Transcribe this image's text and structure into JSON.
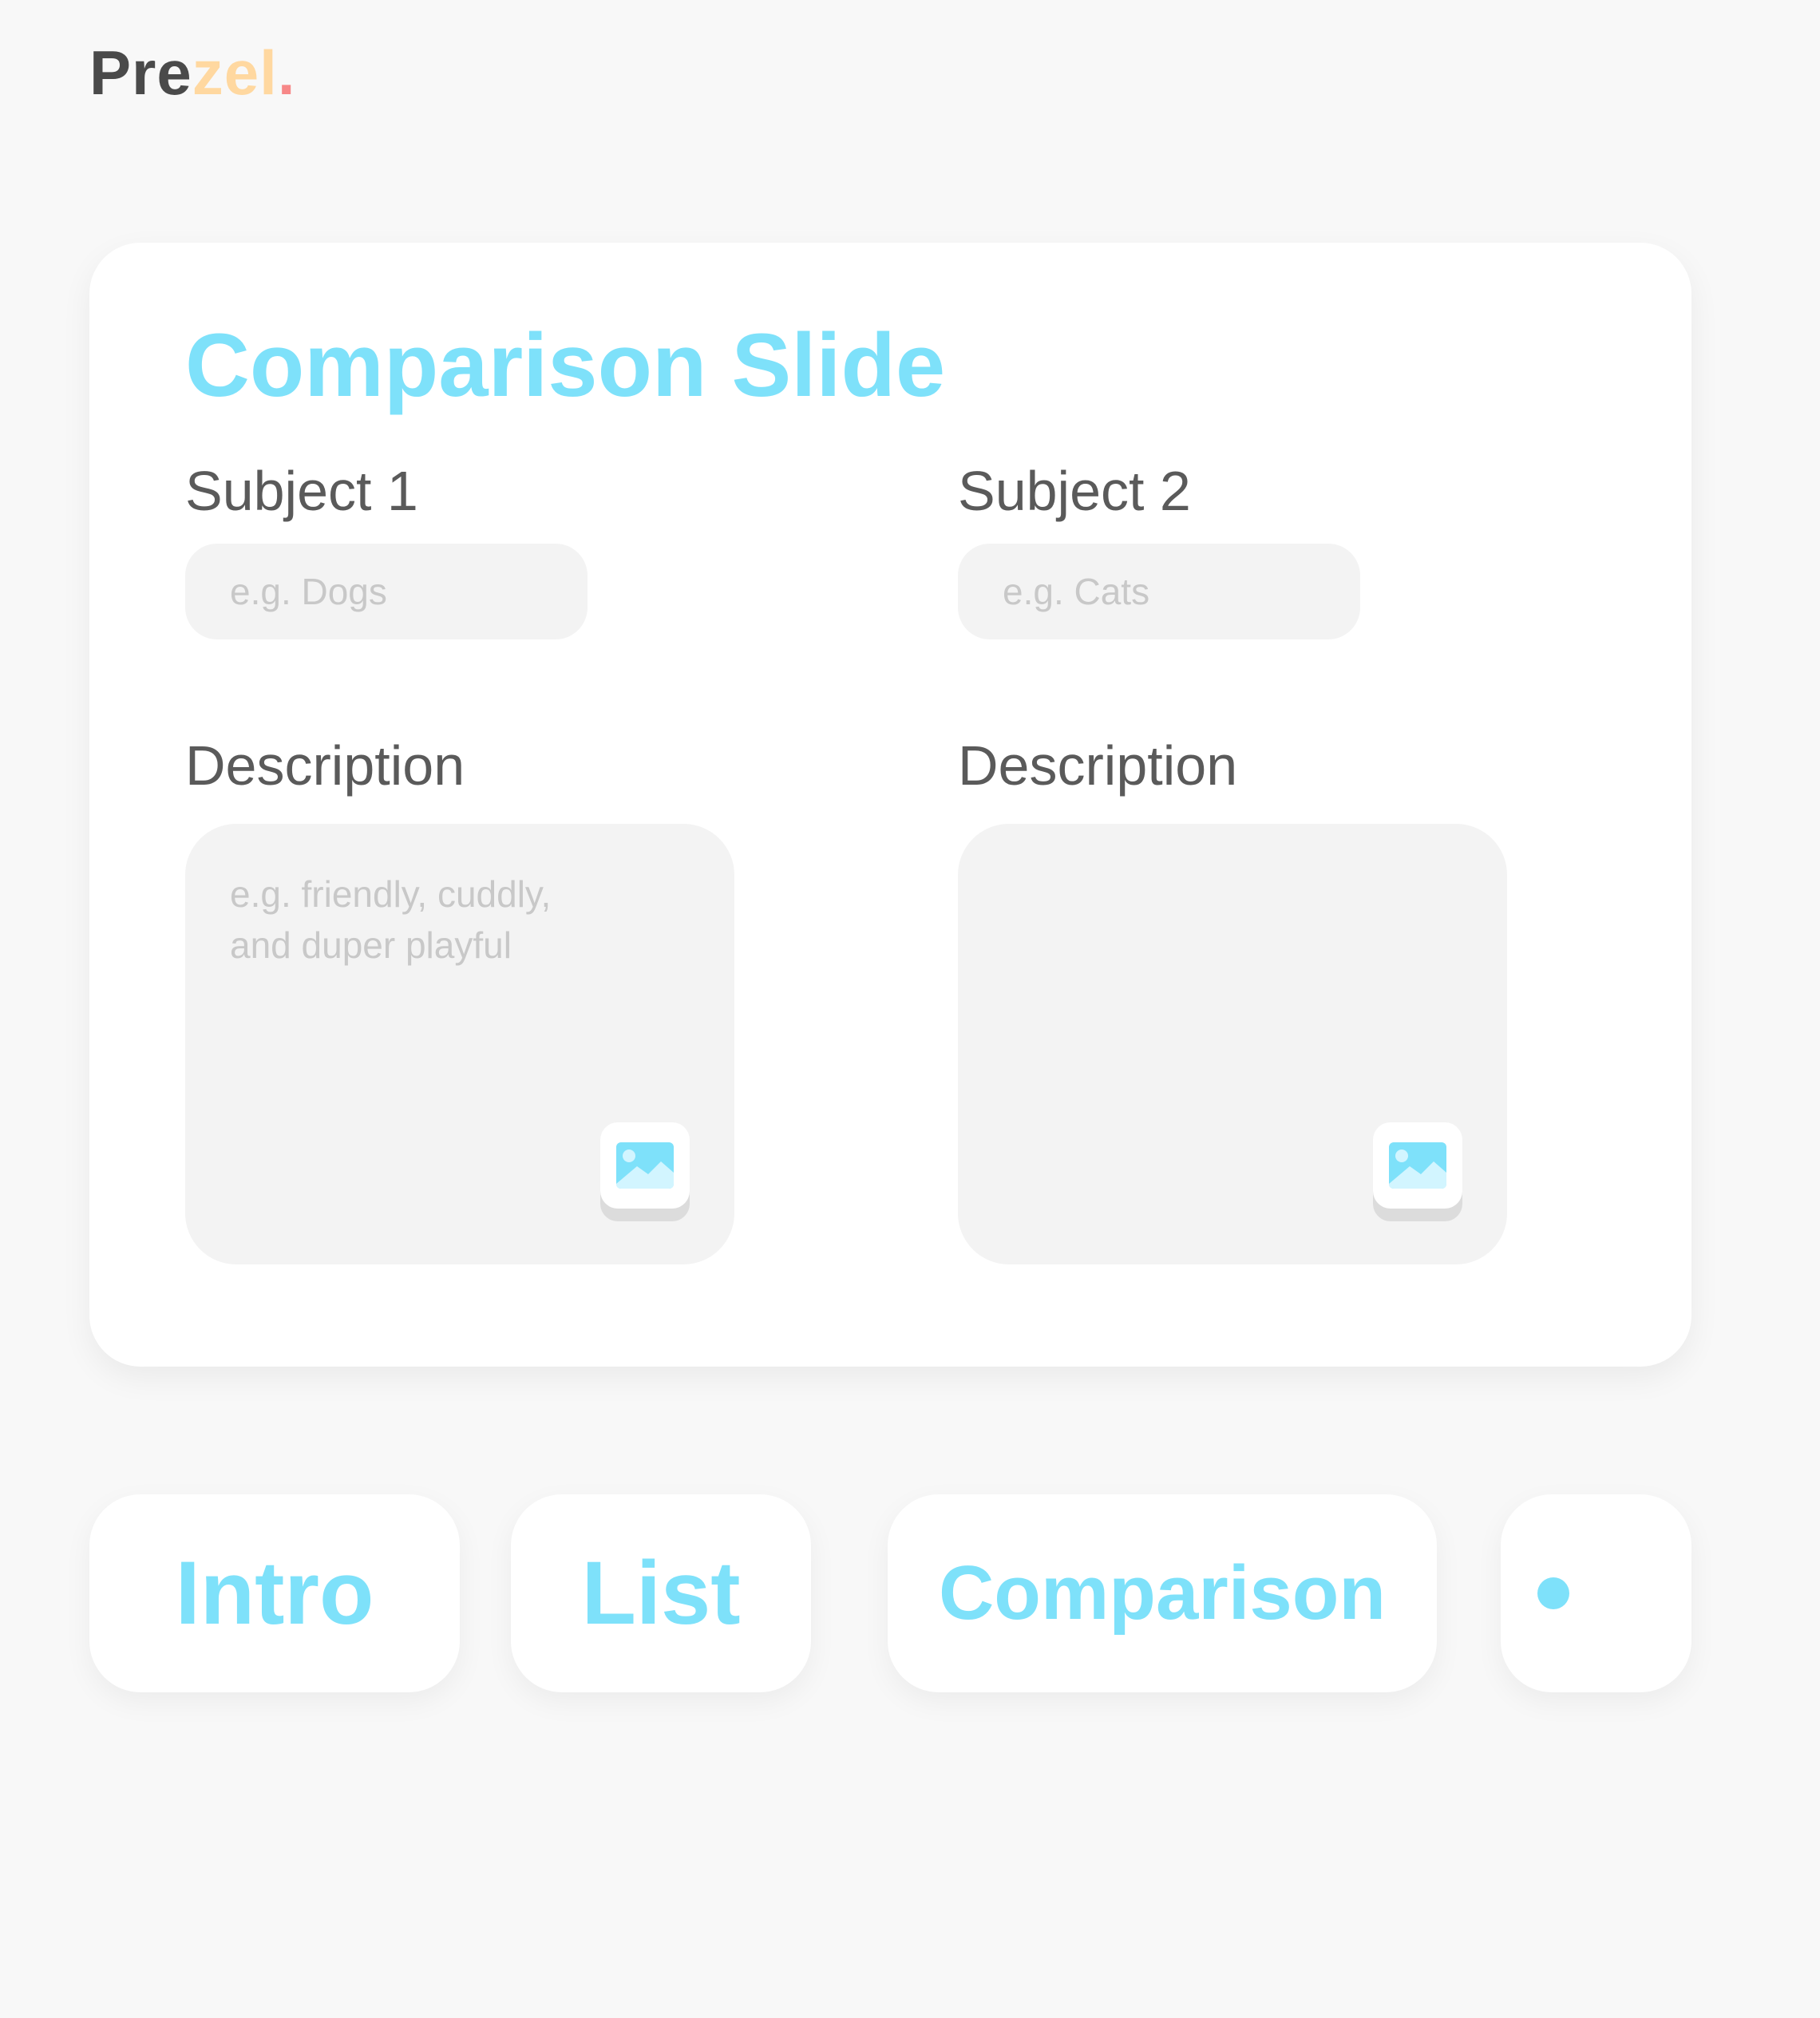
{
  "logo": {
    "part1": "Pre",
    "part2": "zel",
    "part3": ".",
    "colors": {
      "part1": "#4a4a4a",
      "part2": "#ffd8a0",
      "part3": "#f78888"
    }
  },
  "card": {
    "title": "Comparison Slide",
    "subject1": {
      "label": "Subject 1",
      "placeholder": "e.g. Dogs",
      "description_label": "Description",
      "description_placeholder": "e.g. friendly, cuddly,\nand duper playful",
      "image_button_icon": "image-icon"
    },
    "subject2": {
      "label": "Subject 2",
      "placeholder": "e.g. Cats",
      "description_label": "Description",
      "description_placeholder": "",
      "image_button_icon": "image-icon"
    }
  },
  "tabs": [
    {
      "label": "Intro"
    },
    {
      "label": "List"
    },
    {
      "label": "Comparison"
    },
    {
      "label": "",
      "icon": "dot-icon"
    }
  ],
  "colors": {
    "accent": "#7ee1fa",
    "background": "#f8f8f8",
    "card": "#ffffff",
    "input": "#f3f3f3",
    "label": "#5a5a5a",
    "placeholder": "#c8c8c8"
  }
}
